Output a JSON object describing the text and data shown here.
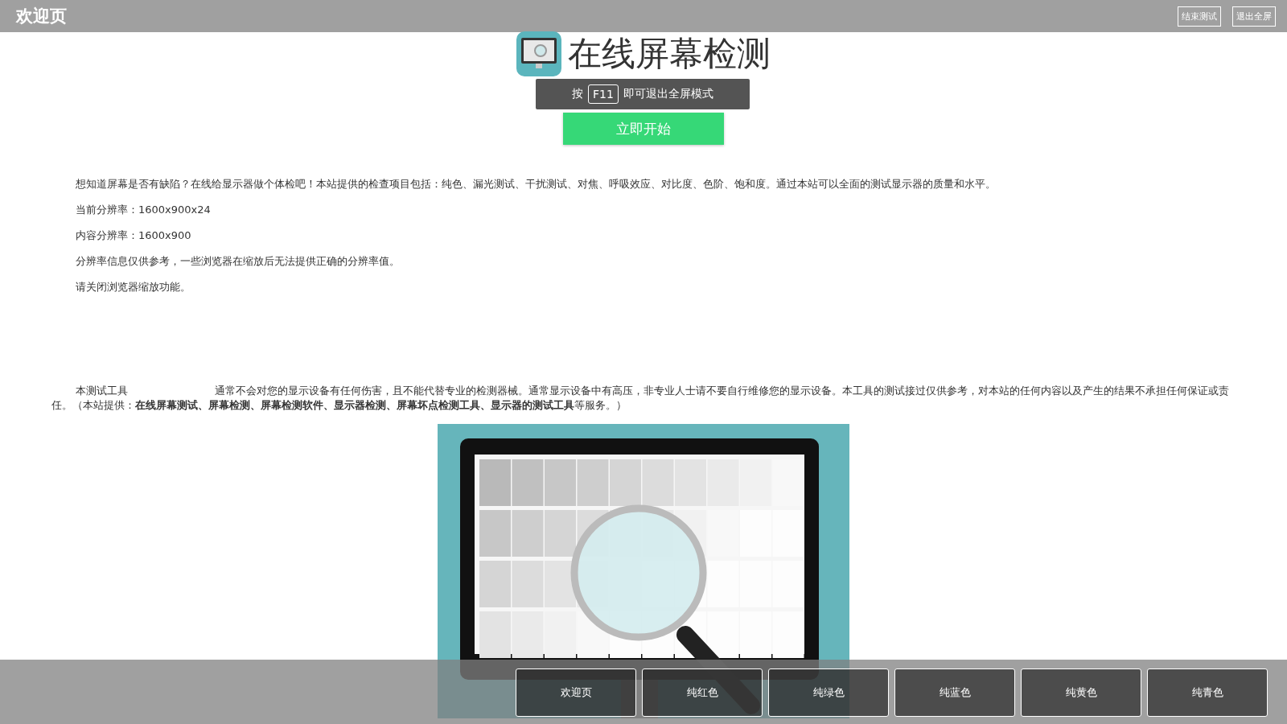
{
  "top_bar": {
    "title": "欢迎页",
    "buttons": [
      {
        "label": "结束测试"
      },
      {
        "label": "退出全屏"
      }
    ]
  },
  "site_title": "在线屏幕检测",
  "toast": {
    "before": "按",
    "key": "F11",
    "after": "即可退出全屏模式"
  },
  "start_button": "立即开始",
  "info_lines": [
    "想知道屏幕是否有缺陷？在线给显示器做个体检吧！本站提供的检查项目包括：纯色、漏光测试、干扰测试、对焦、呼吸效应、对比度、色阶、饱和度。通过本站可以全面的测试显示器的质量和水平。",
    "当前分辨率：1600x900x24",
    "内容分辨率：1600x900",
    "分辨率信息仅供参考，一些浏览器在缩放后无法提供正确的分辨率值。",
    "请关闭浏览器缩放功能。"
  ],
  "disclaimer": {
    "before": "本测试工具",
    "after": "通常不会对您的显示设备有任何伤害，且不能代替专业的检测器械。通常显示设备中有高压，非专业人士请不要自行维修您的显示设备。本工具的测试接过仅供参考，对本站的任何内容以及产生的结果不承担任何保证或责任。（本站提供：**在线屏幕测试、屏幕检测、屏幕检测软件、显示器检测、屏幕坏点检测工具、显示器的测试工具**等服务。）"
  },
  "nav_buttons": [
    {
      "label": "欢迎页"
    },
    {
      "label": "纯红色"
    },
    {
      "label": "纯绿色"
    },
    {
      "label": "纯蓝色"
    },
    {
      "label": "纯黄色"
    },
    {
      "label": "纯青色"
    }
  ]
}
